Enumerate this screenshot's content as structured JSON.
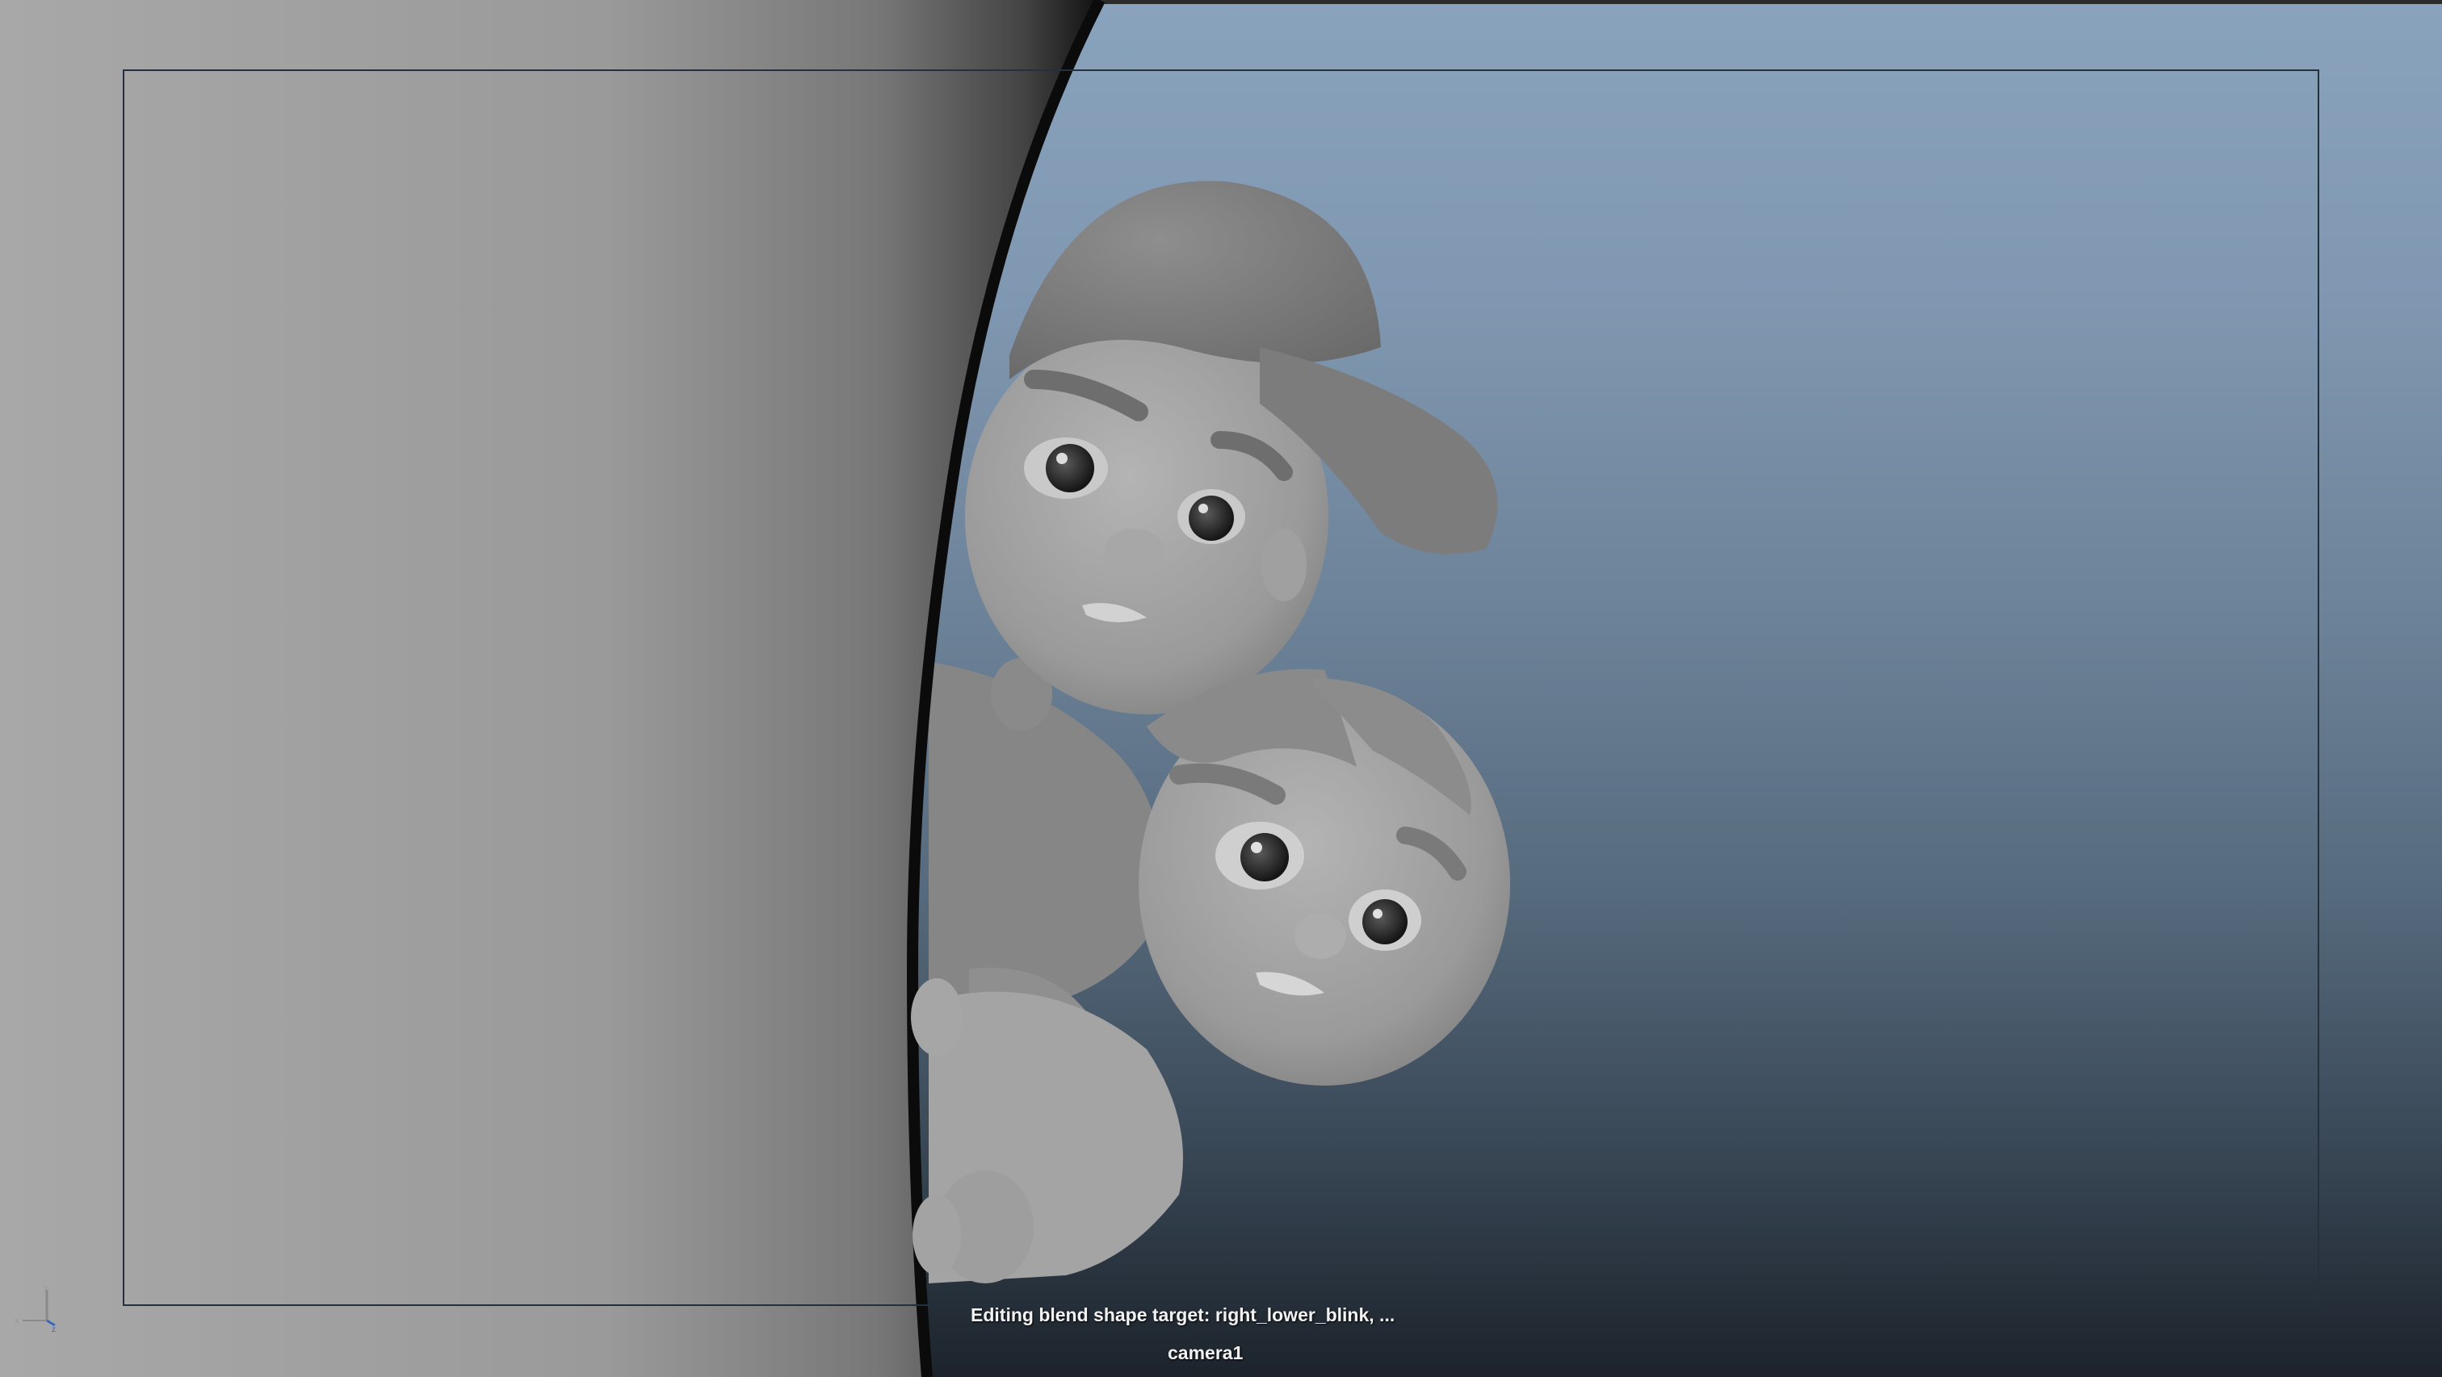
{
  "viewport": {
    "hud_message": "Editing blend shape target: right_lower_blink, ...",
    "camera_name": "camera1"
  },
  "axis_gizmo": {
    "x_label": "x",
    "y_label": "y",
    "z_label": "z"
  },
  "colors": {
    "background_top": "#8aa3bd",
    "background_bottom": "#1c232b",
    "wall_gray": "#a9a9a9",
    "character_gray": "#9a9a9a",
    "gate_line": "#24303c",
    "hud_text": "#f2f2f2"
  }
}
